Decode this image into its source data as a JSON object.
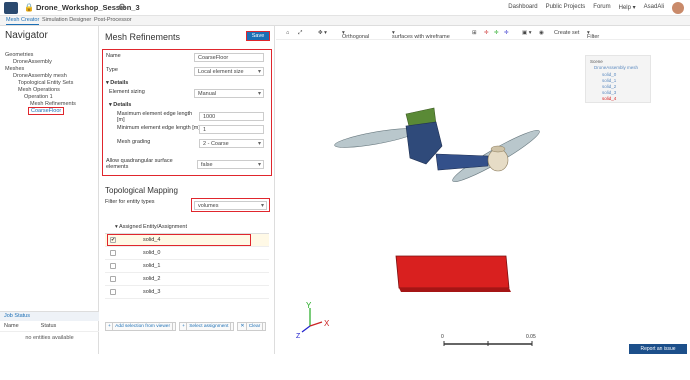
{
  "header": {
    "project": "Drone_Workshop_Session_3",
    "nav": [
      "Dashboard",
      "Public Projects",
      "Forum",
      "Help ▾",
      "AsadAli"
    ]
  },
  "tabs": [
    "Mesh Creator",
    "Simulation Designer",
    "Post-Processor"
  ],
  "navigator": {
    "title": "Navigator",
    "tree": [
      "Geometries",
      "DroneAssembly",
      "Meshes",
      "DroneAssembly mesh",
      "Topological Entity Sets",
      "Mesh Operations",
      "Operation 1",
      "Mesh Refinements",
      "CoarseFloor"
    ]
  },
  "jobs": {
    "title": "Job Status",
    "col_name": "Name",
    "col_status": "Status",
    "empty": "no entities available"
  },
  "panel": {
    "title": "Mesh Refinements",
    "save": "Save",
    "name_label": "Name",
    "name_value": "CoarseFloor",
    "type_label": "Type",
    "type_value": "Local element size",
    "details": "Details",
    "sizing_label": "Element sizing",
    "sizing_value": "Manual",
    "details2": "Details",
    "max_label": "Maximum element edge length [m]",
    "max_value": "1000",
    "min_label": "Minimum element edge length [m]",
    "min_value": "1",
    "grading_label": "Mesh grading",
    "grading_value": "2 - Coarse",
    "quad_label": "Allow quadrangular surface elements",
    "quad_value": "false",
    "topo_title": "Topological Mapping",
    "filter_label": "Filter for entity types",
    "filter_value": "volumes",
    "col_assigned": "Assigned",
    "col_entity": "Entity/Assignment",
    "rows": [
      "solid_4",
      "solid_0",
      "solid_1",
      "solid_2",
      "solid_3"
    ],
    "btn_add": "Add selection from viewer",
    "btn_select": "Select assignment",
    "btn_clear": "Clear"
  },
  "viewer": {
    "toolbar": {
      "ortho": "Orthogonal",
      "render": "surfaces with wireframe",
      "create_set": "Create set",
      "filter": "Filter"
    },
    "legend": {
      "title": "Scene",
      "group": "DroneAssembly mesh",
      "items": [
        "solid_0",
        "solid_1",
        "solid_2",
        "solid_3",
        "solid_4"
      ]
    },
    "scale": {
      "start": "0",
      "end": "0.05"
    },
    "axes": {
      "y": "Y",
      "x": "X",
      "z": "Z"
    },
    "report": "Report an issue"
  },
  "colors": {
    "accent": "#1c6fb5",
    "highlight": "#e0262d",
    "floor": "#d9201f"
  }
}
